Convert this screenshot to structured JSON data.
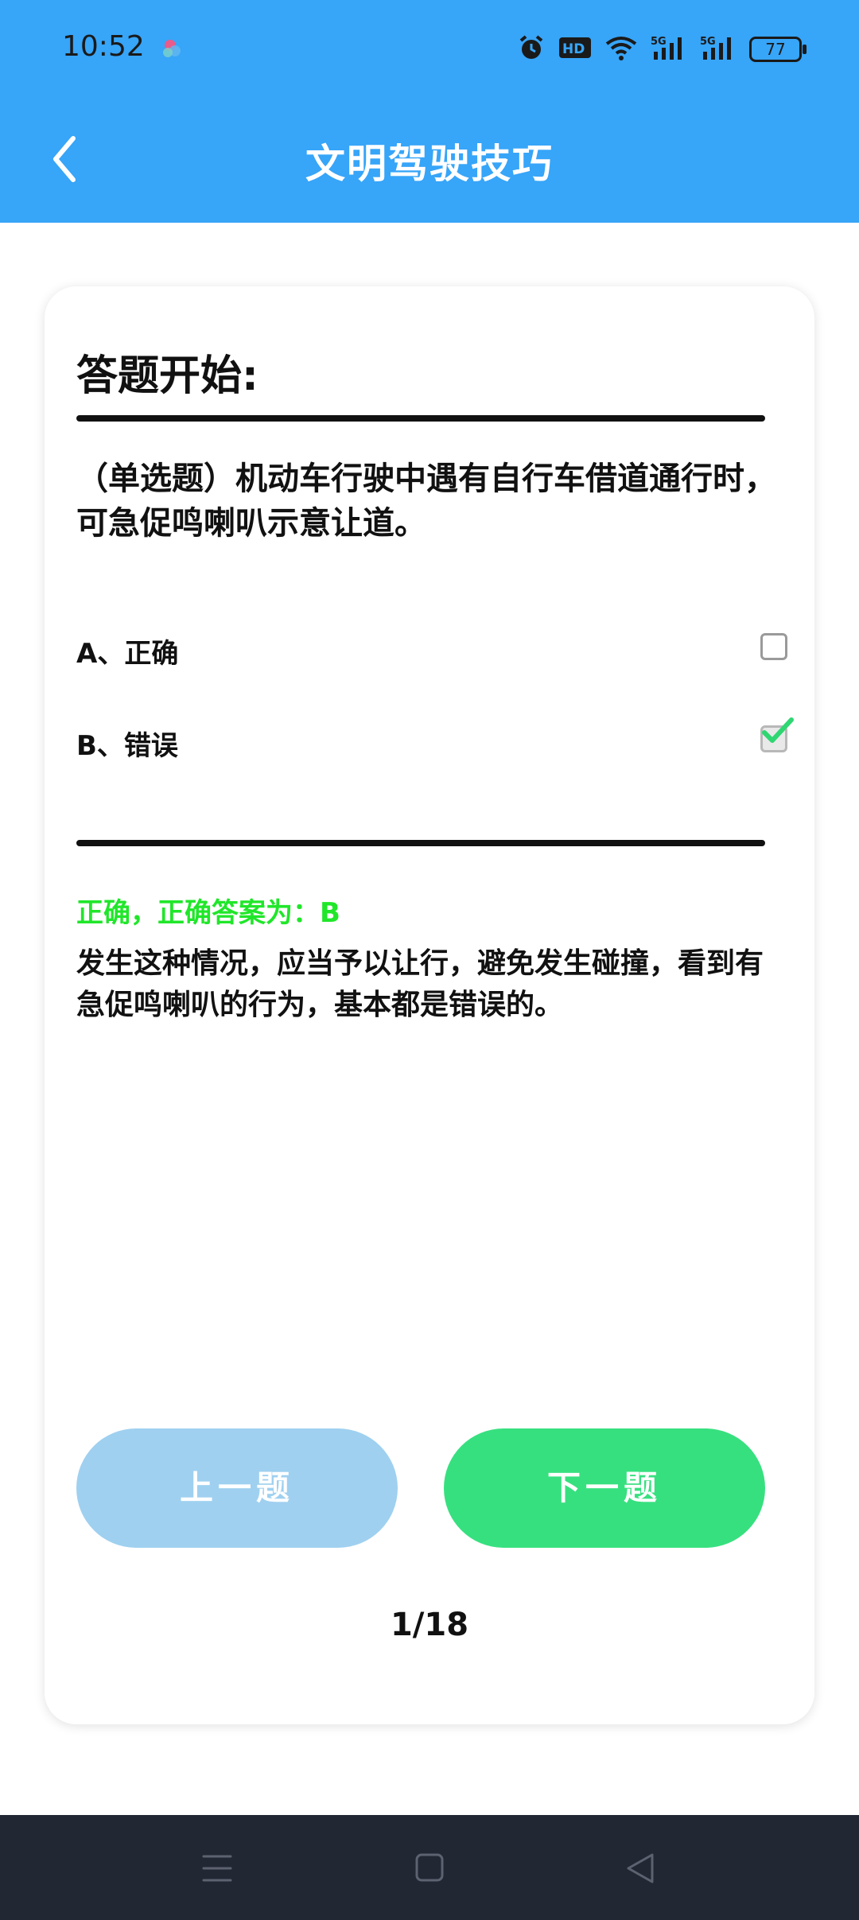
{
  "status_bar": {
    "time": "10:52",
    "battery": "77",
    "network_labels": [
      "HD",
      "5G",
      "5G"
    ]
  },
  "header": {
    "title": "文明驾驶技巧",
    "back_icon": "chevron-left-icon"
  },
  "quiz": {
    "heading": "答题开始:",
    "question": "（单选题）机动车行驶中遇有自行车借道通行时，可急促鸣喇叭示意让道。",
    "options": [
      {
        "label": "A、正确",
        "checked": false
      },
      {
        "label": "B、错误",
        "checked": true
      }
    ],
    "result": "正确，正确答案为：B",
    "explanation": "发生这种情况，应当予以让行，避免发生碰撞，看到有急促鸣喇叭的行为，基本都是错误的。",
    "prev_label": "上一题",
    "next_label": "下一题",
    "pager": "1/18"
  },
  "colors": {
    "header_bg": "#37a5f8",
    "result_text": "#20e62a",
    "next_button": "#37e07f",
    "prev_button": "#9fd0f0",
    "nav_bar": "#222734"
  }
}
